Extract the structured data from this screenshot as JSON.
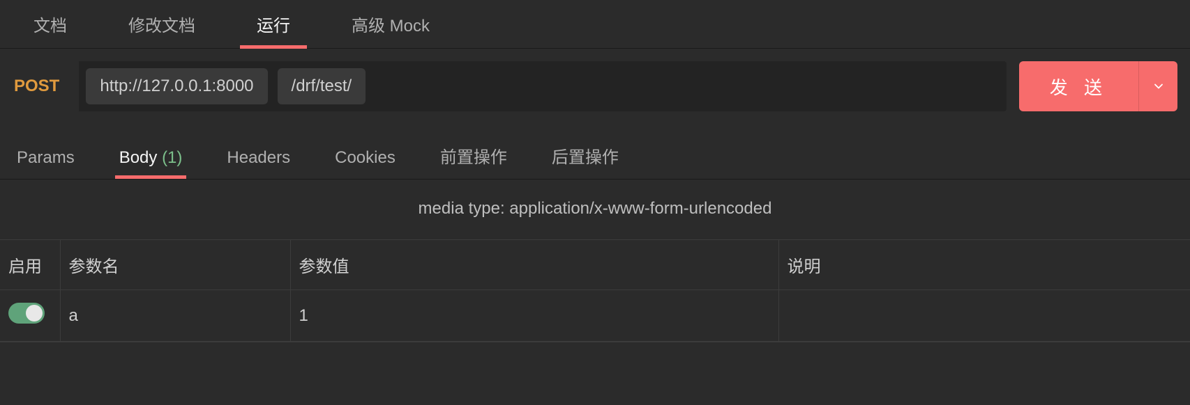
{
  "topTabs": {
    "items": [
      {
        "label": "文档",
        "active": false
      },
      {
        "label": "修改文档",
        "active": false
      },
      {
        "label": "运行",
        "active": true
      },
      {
        "label": "高级 Mock",
        "active": false
      }
    ]
  },
  "request": {
    "method": "POST",
    "host": "http://127.0.0.1:8000",
    "path": "/drf/test/",
    "sendLabel": "发 送"
  },
  "subTabs": {
    "items": [
      {
        "label": "Params",
        "count": null,
        "active": false
      },
      {
        "label": "Body",
        "count": "(1)",
        "active": true
      },
      {
        "label": "Headers",
        "count": null,
        "active": false
      },
      {
        "label": "Cookies",
        "count": null,
        "active": false
      },
      {
        "label": "前置操作",
        "count": null,
        "active": false
      },
      {
        "label": "后置操作",
        "count": null,
        "active": false
      }
    ]
  },
  "mediaType": "media type: application/x-www-form-urlencoded",
  "paramsTable": {
    "headers": {
      "enable": "启用",
      "name": "参数名",
      "value": "参数值",
      "desc": "说明"
    },
    "rows": [
      {
        "enabled": true,
        "name": "a",
        "value": "1",
        "desc": ""
      }
    ]
  }
}
